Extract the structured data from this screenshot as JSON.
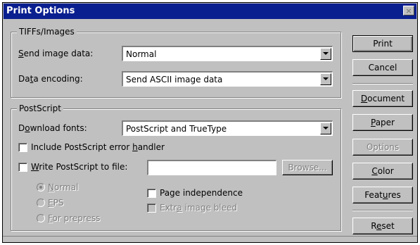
{
  "window": {
    "title": "Print Options",
    "close_glyph": "×"
  },
  "tiffs": {
    "legend": "TIFFs/Images",
    "send_image_label": "Send image data:",
    "send_image_value": "Normal",
    "encoding_label": "Data encoding:",
    "encoding_value": "Send ASCII image data"
  },
  "postscript": {
    "legend": "PostScript",
    "download_fonts_label": "Download fonts:",
    "download_fonts_value": "PostScript and TrueType",
    "include_error_handler": "Include PostScript error handler",
    "write_to_file": "Write PostScript to file:",
    "file_value": "",
    "browse": "Browse...",
    "radio_normal": "Normal",
    "radio_eps": "EPS",
    "radio_prepress": "For prepress",
    "page_independence": "Page independence",
    "extra_bleed": "Extra image bleed"
  },
  "buttons": {
    "print": "Print",
    "cancel": "Cancel",
    "document": "Document",
    "paper": "Paper",
    "options": "Options",
    "color": "Color",
    "features": "Features",
    "reset": "Reset"
  },
  "state": {
    "include_error_handler": false,
    "write_to_file": false,
    "output_mode": "Normal",
    "page_independence": false,
    "extra_bleed": false
  },
  "icons": {
    "combo_arrow": "chevron-down-icon",
    "close": "close-icon"
  },
  "colors": {
    "titlebar": "#0a1f8f",
    "dialog": "#c0c0c0"
  }
}
